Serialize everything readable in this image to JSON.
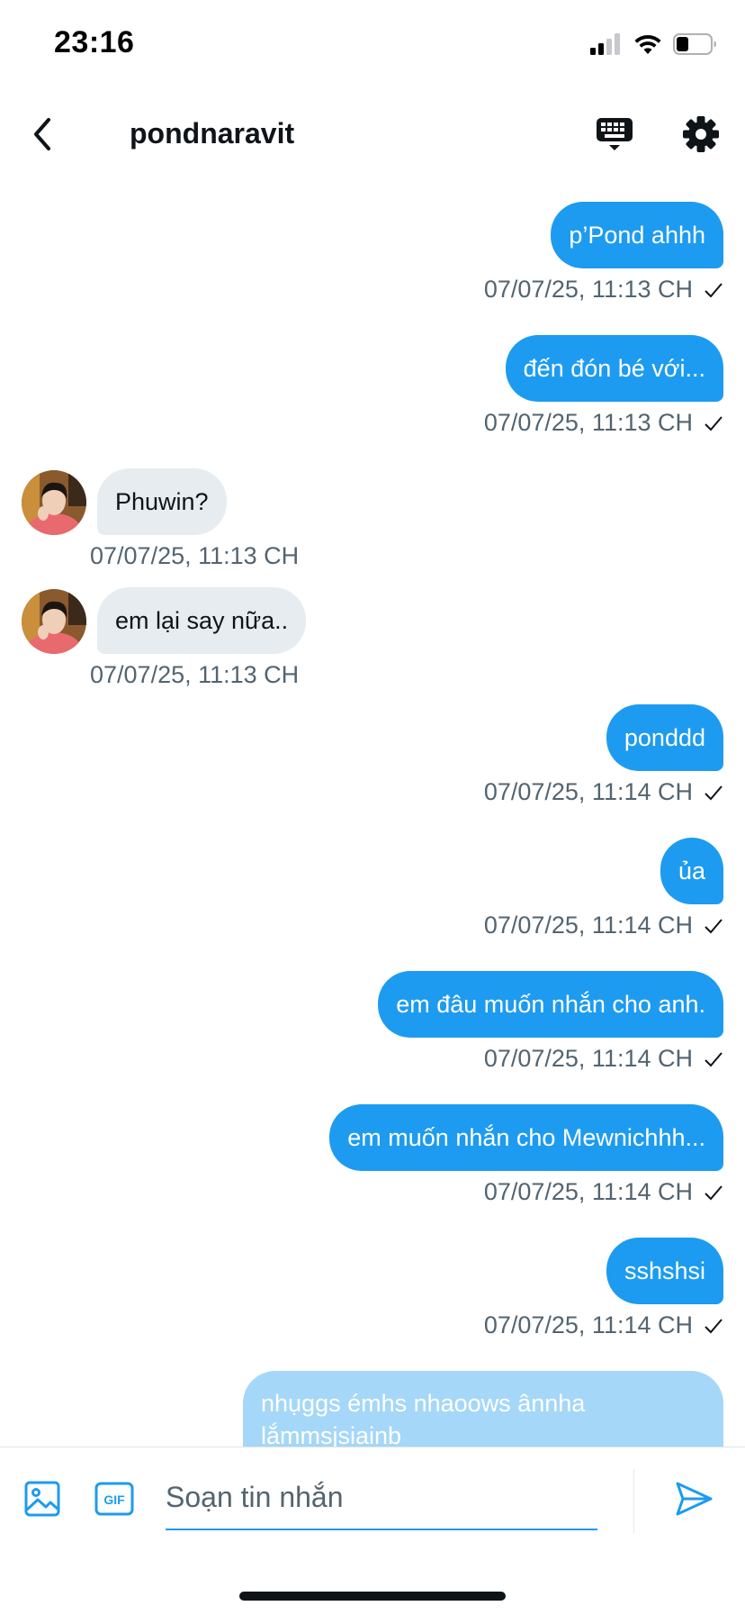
{
  "status_bar": {
    "time": "23:16"
  },
  "header": {
    "title": "pondnaravit",
    "icons": {
      "back": "back-chevron-icon",
      "keyboard": "keyboard-icon",
      "settings": "gear-icon"
    }
  },
  "colors": {
    "accent": "#1d9bf0",
    "incoming_bubble": "#e7ecf0",
    "pending_bubble": "#a5d7f8",
    "meta_text": "#536471"
  },
  "messages": [
    {
      "direction": "out",
      "text": "p’Pond ahhh",
      "time": "07/07/25, 11:13 CH"
    },
    {
      "direction": "out",
      "text": "đến đón bé với...",
      "time": "07/07/25, 11:13 CH"
    },
    {
      "direction": "in",
      "text": "Phuwin?",
      "time": "07/07/25, 11:13 CH"
    },
    {
      "direction": "in",
      "text": "em lại say nữa..",
      "time": "07/07/25, 11:13 CH"
    },
    {
      "direction": "out",
      "text": "ponddd",
      "time": "07/07/25, 11:14 CH"
    },
    {
      "direction": "out",
      "text": "ủa",
      "time": "07/07/25, 11:14 CH"
    },
    {
      "direction": "out",
      "text": "em đâu muốn nhắn cho anh.",
      "time": "07/07/25, 11:14 CH"
    },
    {
      "direction": "out",
      "text": "em muốn nhắn cho Mewnichhh...",
      "time": "07/07/25, 11:14 CH"
    },
    {
      "direction": "out",
      "text": "sshshsi",
      "time": "07/07/25, 11:14 CH"
    },
    {
      "direction": "out_pending",
      "text": "nhụggs émhs nhaoows ânnha lắmmsjsiainb"
    }
  ],
  "composer": {
    "placeholder": "Soạn tin nhắn",
    "icons": {
      "image": "image-icon",
      "gif": "gif-icon",
      "send": "send-icon"
    },
    "gif_label": "GIF"
  }
}
